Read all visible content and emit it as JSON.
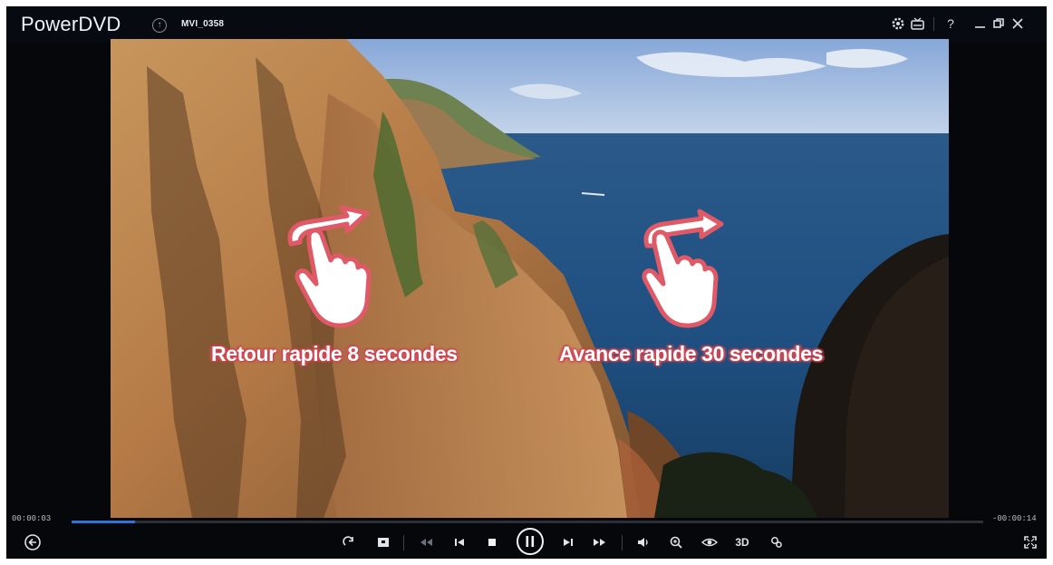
{
  "app": {
    "title": "PowerDVD",
    "file_name": "MVI_0358"
  },
  "title_controls": [
    "settings-icon",
    "tv-mode-icon",
    "help-icon",
    "minimize-icon",
    "restore-icon",
    "close-icon"
  ],
  "help_label": "?",
  "overlay": {
    "rewind_hint": "Retour rapide 8 secondes",
    "forward_hint": "Avance rapide 30 secondes"
  },
  "playback": {
    "elapsed": "00:00:03",
    "remaining": "-00:00:14",
    "progress_fraction": 0.07
  },
  "controls": {
    "repeat": "repeat-icon",
    "snapshot": "snapshot-icon",
    "rewind": "rewind-icon",
    "previous": "previous-icon",
    "stop": "stop-icon",
    "pause": "pause-icon",
    "next": "next-icon",
    "fast_forward": "fast-forward-icon",
    "volume": "volume-icon",
    "zoom": "zoom-icon",
    "eye_care": "eye-icon",
    "three_d_label": "3D",
    "more": "more-icon",
    "fullscreen": "fullscreen-icon",
    "back": "back-icon"
  },
  "colors": {
    "accent": "#2f72d8",
    "hint_outline": "#d44955"
  }
}
